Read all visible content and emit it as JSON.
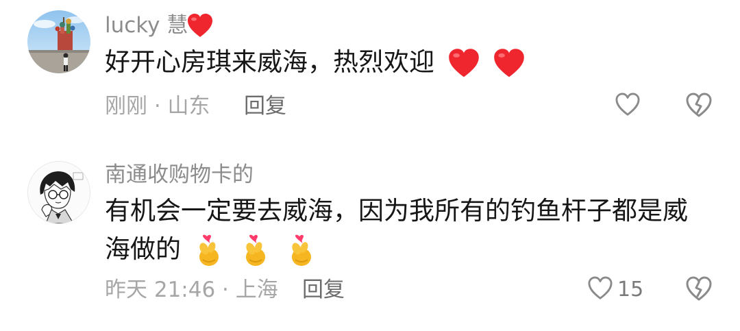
{
  "comments": [
    {
      "username": "lucky 慧",
      "username_emoji": "red-heart",
      "text": "好开心房琪来威海，热烈欢迎",
      "text_emojis": [
        "red-heart",
        "red-heart"
      ],
      "time": "刚刚 · 山东",
      "reply_label": "回复",
      "like_count": "",
      "avatar": "photo-person-in-front-of-cathedral"
    },
    {
      "username": "南通收购物卡的",
      "text_line1": "有机会一定要去威海，因为我所有的钓鱼杆子都是威",
      "text_line2": "海做的",
      "text_emojis": [
        "finger-heart",
        "finger-heart",
        "finger-heart"
      ],
      "time": "昨天 21:46 · 上海",
      "reply_label": "回复",
      "like_count": "15",
      "avatar": "anime-boy-with-glasses-sketch"
    }
  ],
  "colors": {
    "username": "#8c8c8c",
    "text": "#161616",
    "meta": "#a6a6a6",
    "reply": "#6c6c6c",
    "heart_red": "#f0262f",
    "icon_gray": "#8a8a8a"
  }
}
